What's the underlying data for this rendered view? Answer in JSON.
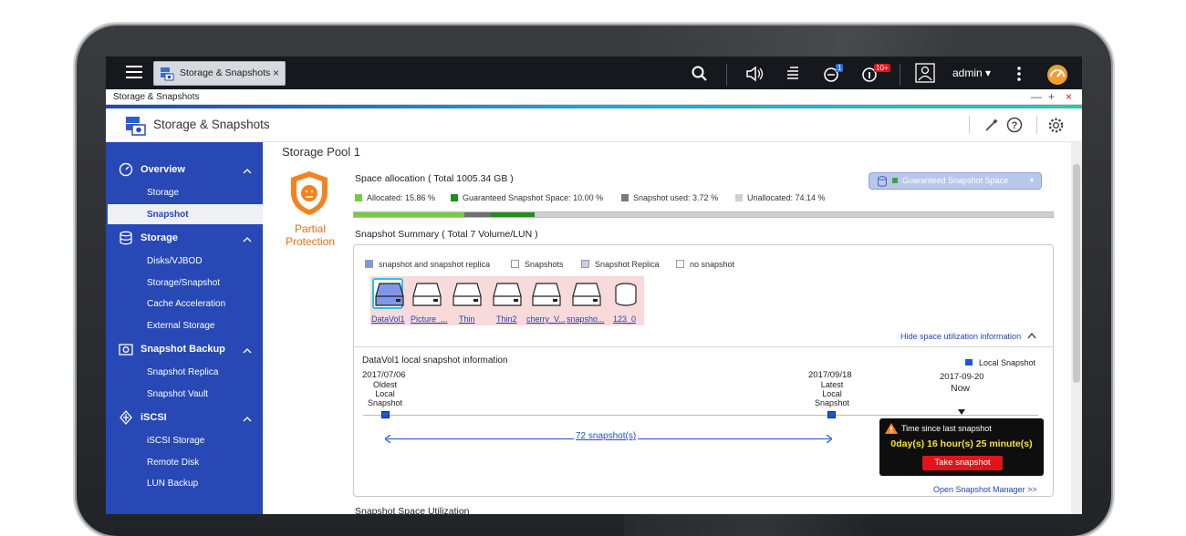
{
  "tab": {
    "title": "Storage & Snapshots",
    "close": "×"
  },
  "topbar": {
    "user": "admin",
    "badge_notifications": "1",
    "badge_info": "10+"
  },
  "window": {
    "title": "Storage & Snapshots",
    "minimize": "—",
    "maximize": "+",
    "close": "×"
  },
  "app": {
    "title": "Storage & Snapshots"
  },
  "sidebar": {
    "overview": {
      "label": "Overview",
      "items": [
        "Storage",
        "Snapshot"
      ]
    },
    "storage": {
      "label": "Storage",
      "items": [
        "Disks/VJBOD",
        "Storage/Snapshot",
        "Cache Acceleration",
        "External Storage"
      ]
    },
    "backup": {
      "label": "Snapshot Backup",
      "items": [
        "Snapshot Replica",
        "Snapshot Vault"
      ]
    },
    "iscsi": {
      "label": "iSCSI",
      "items": [
        "iSCSI Storage",
        "Remote Disk",
        "LUN Backup"
      ]
    },
    "selected": "Snapshot"
  },
  "pool": {
    "title": "Storage Pool 1",
    "status_line1": "Partial",
    "status_line2": "Protection",
    "space_title": "Space allocation ( Total 1005.34 GB )",
    "guaranteed_button": "Guaranteed Snapshot Space",
    "legend": [
      {
        "label": "Allocated: 15.86 %",
        "color": "#7ac943"
      },
      {
        "label": "Guaranteed Snapshot Space: 10.00 %",
        "color": "#1e8f1e"
      },
      {
        "label": "Snapshot used: 3.72 %",
        "color": "#7a7a7a"
      },
      {
        "label": "Unallocated: 74.14 %",
        "color": "#cfcfcf"
      }
    ],
    "bar": [
      15.86,
      3.72,
      6.28,
      74.14
    ]
  },
  "summary": {
    "title": "Snapshot Summary ( Total 7 Volume/LUN )",
    "legend": [
      "snapshot and snapshot replica",
      "Snapshots",
      "Snapshot Replica",
      "no snapshot"
    ],
    "legend_colors": [
      "#7f97e6",
      "#ffffff",
      "#c8cdf0",
      "#ffffff"
    ],
    "volumes": [
      "DataVol1",
      "Picture_...",
      "Thin",
      "Thin2",
      "cherry_V...",
      "snapsho...",
      "123_0"
    ],
    "hide_link": "Hide space utilization information"
  },
  "snapinfo": {
    "title": "DataVol1 local snapshot information",
    "legend": "Local Snapshot",
    "oldest_date": "2017/07/06",
    "oldest_l1": "Oldest",
    "oldest_l2": "Local",
    "oldest_l3": "Snapshot",
    "latest_date": "2017/09/18",
    "latest_l1": "Latest",
    "latest_l2": "Local",
    "latest_l3": "Snapshot",
    "now_date": "2017-09-20",
    "now_label": "Now",
    "count": "72 snapshot(s)",
    "popup_title": "Time since last snapshot",
    "popup_value": "0day(s) 16 hour(s) 25 minute(s)",
    "popup_button": "Take snapshot",
    "open_link": "Open Snapshot Manager >>"
  },
  "bottom": {
    "title": "Snapshot Space Utilization"
  }
}
